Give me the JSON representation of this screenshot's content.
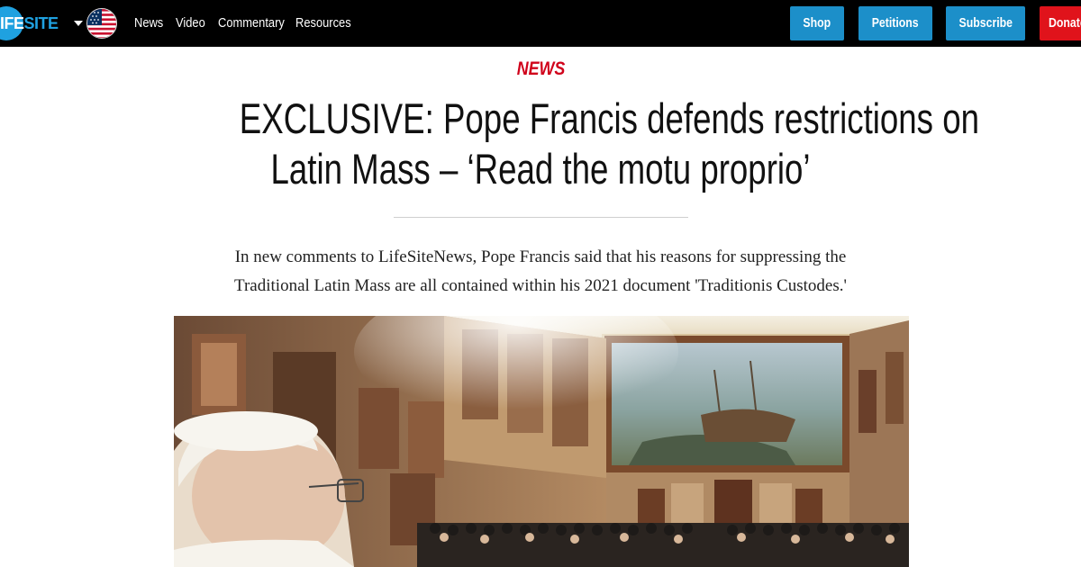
{
  "header": {
    "logo": {
      "part1": "IFE",
      "part2": "SITE"
    },
    "region_icon": "us-flag-icon",
    "nav": [
      "News",
      "Video",
      "Commentary",
      "Resources"
    ],
    "buttons": [
      {
        "label": "Shop",
        "color": "#1c8fc9"
      },
      {
        "label": "Petitions",
        "color": "#1c8fc9"
      },
      {
        "label": "Subscribe",
        "color": "#1c8fc9"
      },
      {
        "label": "Donate",
        "color": "#e0131b"
      }
    ]
  },
  "article": {
    "category": "NEWS",
    "headline_line1": "EXCLUSIVE: Pope Francis defends restrictions on",
    "headline_line2": "Latin Mass – ‘Read the motu proprio’",
    "dek_line1": "In new comments to LifeSiteNews, Pope Francis said that his reasons for suppressing the",
    "dek_line2": "Traditional Latin Mass are all contained within his 2021 document 'Traditionis Custodes.'",
    "hero_image": "audience-hall-photo"
  },
  "colors": {
    "topbar": "#000000",
    "brand_blue": "#1fa1e0",
    "button_blue": "#1c8fc9",
    "donate_red": "#e0131b",
    "kicker_red": "#d0021b"
  }
}
